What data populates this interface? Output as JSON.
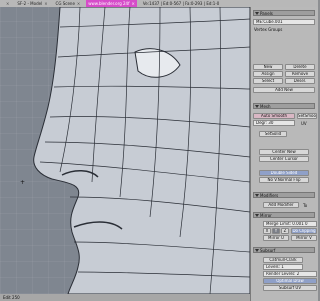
{
  "tabs": [
    {
      "label": "",
      "close": "×"
    },
    {
      "label": "SF-2 - Model",
      "close": "×"
    },
    {
      "label": "CG Scene",
      "close": "×"
    },
    {
      "label": "www.blender.org 24f",
      "close": "×"
    },
    {
      "label": "Ve:1437 | Ed:0-567 | Fa:0-293 | Ed:1-0",
      "close": ""
    }
  ],
  "statusbar": {
    "frame_label": "Edit 250"
  },
  "panel": {
    "title": "Panels",
    "object_field": "ME:Cube.001",
    "vertex_groups_label": "Vertex Groups",
    "new_label": "New",
    "delete_label": "Delete",
    "assign_label": "Assign",
    "remove_label": "Remove",
    "select_label": "Select",
    "deselect_label": "Desel.",
    "addnew_label": "Add New",
    "mesh_header": "Mesh",
    "autosmooth_label": "Auto Smooth",
    "degr_label": "Degr: 30",
    "setsmooth_label": "SetSmoo",
    "uv_label": "UV",
    "setsolid_label": "SetSolid",
    "center_new_label": "Center New",
    "center_cursor_label": "Center Cursor",
    "double_sided_label": "Double Sided",
    "no_v_normal_flip_label": "No V.Normal Flip",
    "modifiers_header": "Modifiers",
    "add_modifier_label": "Add Modifier",
    "to_label": "To",
    "mirror_label": "Mirror",
    "merge_limit_label": "Merge Limit: 0.001 0",
    "x_label": "X",
    "y_label": "Y",
    "z_label": "Z",
    "do_clipping_label": "Do Clipping",
    "mirror_u_label": "Mirror U",
    "mirror_v_label": "Mirror V",
    "subsurf_label": "Subsurf",
    "catmull_label": "Catmull-Clark",
    "levels_label": "Levels: 1",
    "render_levels_label": "Render Levels: 2",
    "optimal_draw_label": "Optimal Draw",
    "subsurf_uv_label": "Subsurf UV"
  },
  "colors": {
    "active_tab": "#d64cc9",
    "viewport_bg": "#7f8690",
    "mesh_fill": "#c9ced6",
    "wire": "#2a2e36"
  },
  "icons": [
    "triangle-icon",
    "cursor-icon"
  ]
}
